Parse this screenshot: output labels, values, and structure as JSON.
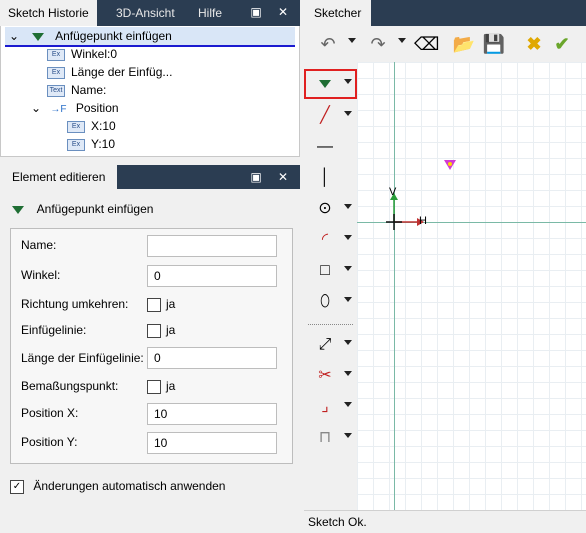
{
  "history_panel": {
    "tabs": [
      "Sketch Historie",
      "3D-Ansicht",
      "Hilfe"
    ],
    "tree": {
      "root": "Anfügepunkt einfügen",
      "items": [
        {
          "badge": "Ex",
          "label": "Winkel:0"
        },
        {
          "badge": "Ex",
          "label": "Länge der Einfüg..."
        },
        {
          "badge": "Text",
          "label": "Name:"
        }
      ],
      "position": {
        "label": "Position",
        "children": [
          {
            "badge": "Ex",
            "label": "X:10"
          },
          {
            "badge": "Ex",
            "label": "Y:10"
          }
        ]
      }
    }
  },
  "edit_panel": {
    "tab": "Element editieren",
    "title": "Anfügepunkt einfügen",
    "fields": {
      "name_label": "Name:",
      "name_value": "",
      "winkel_label": "Winkel:",
      "winkel_value": "0",
      "richtung_label": "Richtung umkehren:",
      "richtung_check": "ja",
      "einfuege_label": "Einfügelinie:",
      "einfuege_check": "ja",
      "laenge_label": "Länge der Einfügelinie:",
      "laenge_value": "0",
      "bemass_label": "Bemaßungspunkt:",
      "bemass_check": "ja",
      "posx_label": "Position X:",
      "posx_value": "10",
      "posy_label": "Position Y:",
      "posy_value": "10"
    },
    "auto_apply": "Änderungen automatisch anwenden"
  },
  "sketcher": {
    "tab": "Sketcher",
    "axis_v": "V",
    "axis_h": "H",
    "status": "Sketch Ok."
  },
  "colors": {
    "panel_header": "#2b3d52",
    "accent_green": "#1f6e34",
    "selection_red": "#e02020"
  }
}
